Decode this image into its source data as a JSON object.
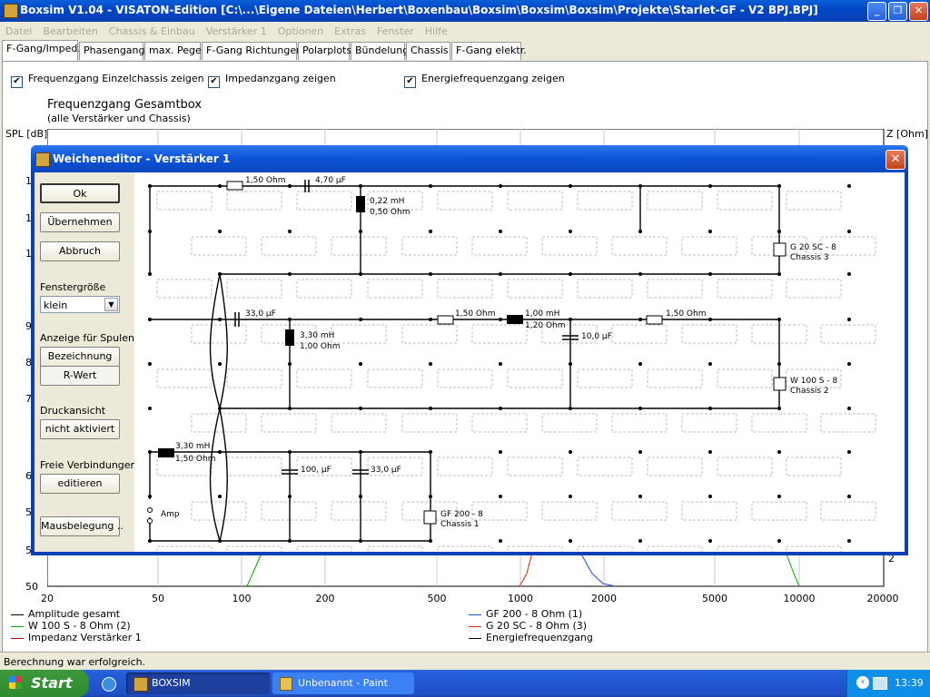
{
  "window": {
    "title": "Boxsim V1.04 - VISATON-Edition [C:\\...\\Eigene Dateien\\Herbert\\Boxenbau\\Boxsim\\Boxsim\\Boxsim\\Projekte\\Starlet-GF - V2 BPJ.BPJ]"
  },
  "menu": [
    "Datei",
    "Bearbeiten",
    "Chassis & Einbau",
    "Verstärker 1",
    "Optionen",
    "Extras",
    "Fenster",
    "Hilfe"
  ],
  "tabs": [
    "F-Gang/Imped.",
    "Phasengang",
    "max. Pegel",
    "F-Gang Richtungen",
    "Polarplots",
    "Bündelung",
    "Chassis",
    "F-Gang elektr."
  ],
  "options": [
    {
      "label": "Frequenzgang Einzelchassis zeigen",
      "checked": true
    },
    {
      "label": "Impedanzgang zeigen",
      "checked": true
    },
    {
      "label": "Energiefrequenzgang zeigen",
      "checked": true
    }
  ],
  "chart": {
    "title": "Frequenzgang Gesamtbox",
    "subtitle": "(alle Verstärker und Chassis)",
    "ylabel_left": "SPL [dB]",
    "ylabel_right": "Z [Ohm]",
    "y_ticks_visible": [
      "1",
      "1",
      "1",
      "9",
      "8",
      "7",
      "6",
      "5",
      "5",
      "50"
    ],
    "x_ticks": [
      "20",
      "50",
      "100",
      "200",
      "500",
      "1000",
      "2000",
      "5000",
      "10000",
      "20000"
    ],
    "right_tick": "2"
  },
  "legend": [
    {
      "label": "Amplitude gesamt",
      "color": "#000000"
    },
    {
      "label": "W 100 S - 8 Ohm (2)",
      "color": "#00aa00"
    },
    {
      "label": "Impedanz Verstärker 1",
      "color": "#cc0000"
    },
    {
      "label": "GF 200 - 8 Ohm (1)",
      "color": "#1f4fd8"
    },
    {
      "label": "G 20 SC - 8 Ohm (3)",
      "color": "#dd2200"
    },
    {
      "label": "Energiefrequenzgang",
      "color": "#000000"
    }
  ],
  "dialog": {
    "title": "Weicheneditor - Verstärker 1",
    "buttons": {
      "ok": "Ok",
      "apply": "Übernehmen",
      "cancel": "Abbruch",
      "coil_name": "Bezeichnung",
      "coil_r": "R-Wert",
      "print": "nicht aktiviert",
      "connections": "editieren",
      "mouse": "Mausbelegung .."
    },
    "labels": {
      "window_size": "Fenstergröße",
      "window_size_value": "klein",
      "coil_display": "Anzeige für Spulen",
      "print_view": "Druckansicht",
      "free_connections": "Freie Verbindungen"
    }
  },
  "circuit": {
    "components": [
      {
        "id": "r1",
        "text": "1,50 Ohm"
      },
      {
        "id": "c1",
        "text": "4,70 µF"
      },
      {
        "id": "l1a",
        "text": "0,22 mH"
      },
      {
        "id": "l1b",
        "text": "0,50 Ohm"
      },
      {
        "id": "d3a",
        "text": "G 20 SC - 8"
      },
      {
        "id": "d3b",
        "text": "Chassis 3"
      },
      {
        "id": "c2",
        "text": "33,0 µF"
      },
      {
        "id": "l2a",
        "text": "3,30 mH"
      },
      {
        "id": "l2b",
        "text": "1,00 Ohm"
      },
      {
        "id": "r2",
        "text": "1,50 Ohm"
      },
      {
        "id": "l3a",
        "text": "1,00 mH"
      },
      {
        "id": "l3b",
        "text": "1,20 Ohm"
      },
      {
        "id": "c3",
        "text": "10,0 µF"
      },
      {
        "id": "r3",
        "text": "1,50 Ohm"
      },
      {
        "id": "d2a",
        "text": "W 100 S - 8"
      },
      {
        "id": "d2b",
        "text": "Chassis 2"
      },
      {
        "id": "l4a",
        "text": "3,30 mH"
      },
      {
        "id": "l4b",
        "text": "1,50 Ohm"
      },
      {
        "id": "c4",
        "text": "100, µF"
      },
      {
        "id": "c5",
        "text": "33,0 µF"
      },
      {
        "id": "d1a",
        "text": "GF 200 - 8"
      },
      {
        "id": "d1b",
        "text": "Chassis 1"
      },
      {
        "id": "amp",
        "text": "Amp"
      }
    ]
  },
  "status": "Berechnung war erfolgreich.",
  "taskbar": {
    "start": "Start",
    "tasks": [
      "BOXSIM",
      "Unbenannt - Paint"
    ],
    "clock": "13:39"
  }
}
